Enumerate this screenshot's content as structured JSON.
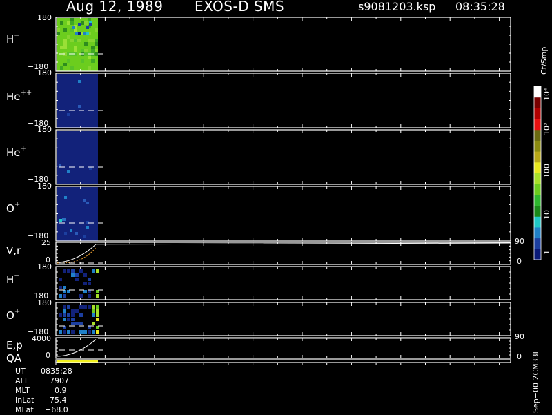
{
  "header": {
    "date": "Aug 12, 1989",
    "instrument": "EXOS-D SMS",
    "filename": "s9081203.ksp",
    "time": "08:35:28"
  },
  "panels": [
    {
      "label": "H",
      "sup": "+",
      "ytop": "180",
      "ybot": "−180"
    },
    {
      "label": "He",
      "sup": "++",
      "ytop": "180",
      "ybot": "−180"
    },
    {
      "label": "He",
      "sup": "+",
      "ytop": "180",
      "ybot": "−180"
    },
    {
      "label": "O",
      "sup": "+",
      "ytop": "180",
      "ybot": "−180"
    },
    {
      "label": "V,r",
      "sup": "",
      "ytop": "25",
      "ybot": "0",
      "right_top": "90",
      "right_bot": "0"
    },
    {
      "label": "H",
      "sup": "+",
      "ytop": "180",
      "ybot": "−180"
    },
    {
      "label": "O",
      "sup": "+",
      "ytop": "180",
      "ybot": "−180"
    },
    {
      "label": "E,p",
      "sup": "",
      "ytop": "4000",
      "ybot": "0",
      "right_top": "90",
      "right_bot": "0"
    }
  ],
  "qa_label": "QA",
  "colorbar": {
    "unit": "Ct/Smp",
    "ticks": [
      "1",
      "10",
      "100",
      "10³",
      "10⁴"
    ]
  },
  "footer_vertical": "Sep−00 2CM33L",
  "info": [
    {
      "key": "UT",
      "value": "0835:28"
    },
    {
      "key": "ALT",
      "value": "7907"
    },
    {
      "key": "MLT",
      "value": "0.9"
    },
    {
      "key": "InLat",
      "value": "75.4"
    },
    {
      "key": "MLat",
      "value": "−68.0"
    }
  ],
  "colors": {
    "background": "#000000",
    "axis": "#ffffff",
    "high_density": "#6ccd1e",
    "low_density": "#12227a",
    "qa_bar": "#f2f01e"
  },
  "chart_data": {
    "type": "heatmap",
    "title": "Aug 12, 1989   EXOS-D SMS",
    "data_extent": "only the first ~10% of the time axis contains data; remainder is blank",
    "colorbar_scale": "log",
    "colorbar_range": [
      1,
      10000
    ],
    "colorbar_colors": [
      "#0a1a78",
      "#1c3fa0",
      "#2080c8",
      "#20c8c8",
      "#1a8a1a",
      "#2eb82e",
      "#6ccd1e",
      "#a8e02a",
      "#e8e820",
      "#b8a818",
      "#8a8a10",
      "#6a6a10",
      "#e81010",
      "#b00000",
      "#780000",
      "#ffffff"
    ]
  }
}
